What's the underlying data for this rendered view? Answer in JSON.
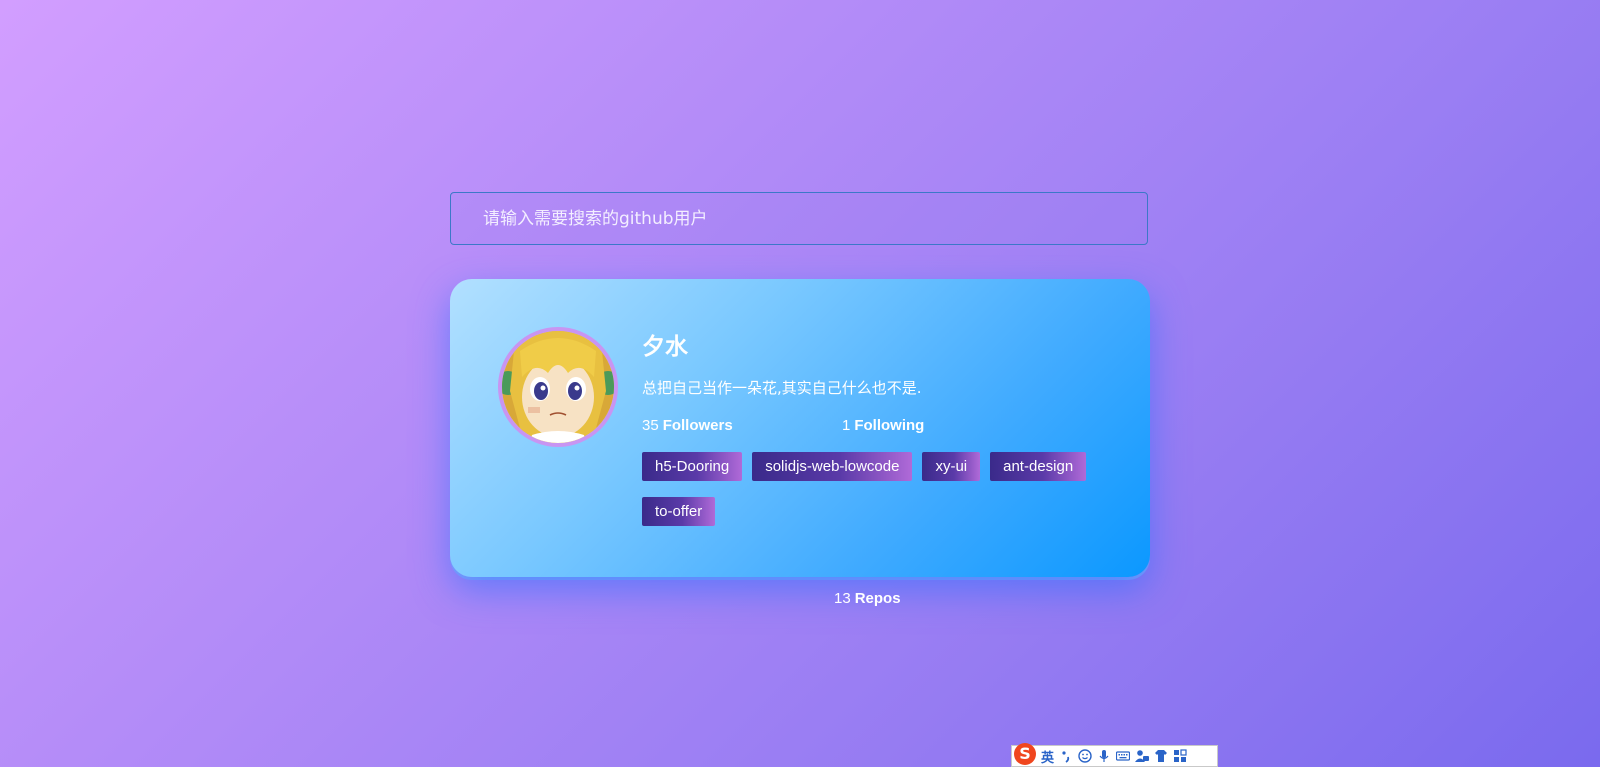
{
  "search": {
    "placeholder": "请输入需要搜索的github用户"
  },
  "profile": {
    "name": "夕水",
    "bio": "总把自己当作一朵花,其实自己什么也不是.",
    "avatar_icon": "anime-girl-avatar",
    "stats": {
      "followers": {
        "count": "35",
        "label": "Followers"
      },
      "following": {
        "count": "1",
        "label": "Following"
      },
      "repos": {
        "count": "13",
        "label": "Repos"
      }
    },
    "repos": [
      "h5-Dooring",
      "solidjs-web-lowcode",
      "xy-ui",
      "ant-design",
      "to-offer"
    ]
  },
  "ime_toolbar": {
    "logo": "S",
    "lang": "英",
    "icons": [
      "punctuation-icon",
      "emoji-icon",
      "microphone-icon",
      "keyboard-icon",
      "user-icon",
      "skin-icon",
      "grid-icon"
    ]
  },
  "colors": {
    "card_start": "#b2e0ff",
    "card_end": "#0b98ff",
    "tag_start": "#3a2a8a",
    "tag_end": "#b06ad8",
    "bg_start": "#d29eff",
    "bg_end": "#7a6aee"
  }
}
